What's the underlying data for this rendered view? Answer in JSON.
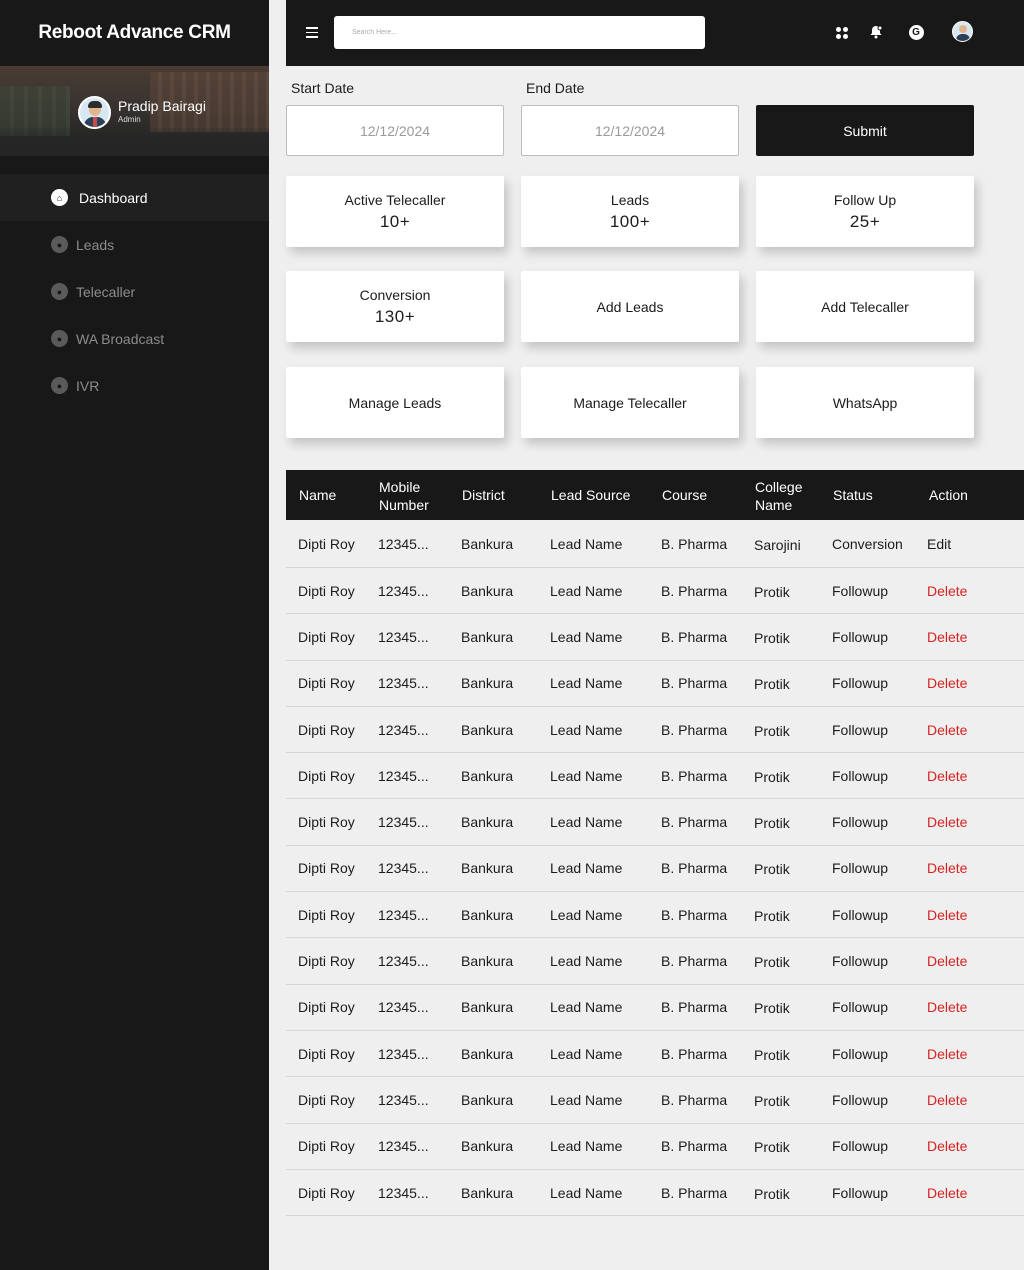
{
  "app": {
    "title": "Reboot Advance CRM"
  },
  "profile": {
    "name": "Pradip Bairagi",
    "role": "Admin"
  },
  "sidebar": {
    "items": [
      {
        "label": "Dashboard",
        "icon": "home-icon",
        "active": true
      },
      {
        "label": "Leads",
        "icon": "leads-icon",
        "active": false
      },
      {
        "label": "Telecaller",
        "icon": "telecaller-icon",
        "active": false
      },
      {
        "label": "WA Broadcast",
        "icon": "broadcast-icon",
        "active": false
      },
      {
        "label": "IVR",
        "icon": "ivr-icon",
        "active": false
      }
    ]
  },
  "header": {
    "search_placeholder": "Search Here..."
  },
  "filters": {
    "start_label": "Start Date",
    "end_label": "End Date",
    "start_value": "12/12/2024",
    "end_value": "12/12/2024",
    "submit_label": "Submit"
  },
  "cards": [
    {
      "label": "Active Telecaller",
      "value": "10+"
    },
    {
      "label": "Leads",
      "value": "100+"
    },
    {
      "label": "Follow Up",
      "value": "25+"
    },
    {
      "label": "Conversion",
      "value": "130+"
    },
    {
      "label": "Add Leads"
    },
    {
      "label": "Add Telecaller"
    },
    {
      "label": "Manage Leads"
    },
    {
      "label": "Manage Telecaller"
    },
    {
      "label": "WhatsApp"
    }
  ],
  "table": {
    "headers": [
      "Name",
      "Mobile Number",
      "District",
      "Lead Source",
      "Course",
      "College Name",
      "Status",
      "Action"
    ],
    "rows": [
      [
        "Dipti Roy",
        "12345...",
        "Bankura",
        "Lead Name",
        "B. Pharma",
        "Sarojini",
        "Conversion",
        "Edit"
      ],
      [
        "Dipti Roy",
        "12345...",
        "Bankura",
        "Lead Name",
        "B. Pharma",
        "Protik",
        "Followup",
        "Delete"
      ],
      [
        "Dipti Roy",
        "12345...",
        "Bankura",
        "Lead Name",
        "B. Pharma",
        "Protik",
        "Followup",
        "Delete"
      ],
      [
        "Dipti Roy",
        "12345...",
        "Bankura",
        "Lead Name",
        "B. Pharma",
        "Protik",
        "Followup",
        "Delete"
      ],
      [
        "Dipti Roy",
        "12345...",
        "Bankura",
        "Lead Name",
        "B. Pharma",
        "Protik",
        "Followup",
        "Delete"
      ],
      [
        "Dipti Roy",
        "12345...",
        "Bankura",
        "Lead Name",
        "B. Pharma",
        "Protik",
        "Followup",
        "Delete"
      ],
      [
        "Dipti Roy",
        "12345...",
        "Bankura",
        "Lead Name",
        "B. Pharma",
        "Protik",
        "Followup",
        "Delete"
      ],
      [
        "Dipti Roy",
        "12345...",
        "Bankura",
        "Lead Name",
        "B. Pharma",
        "Protik",
        "Followup",
        "Delete"
      ],
      [
        "Dipti Roy",
        "12345...",
        "Bankura",
        "Lead Name",
        "B. Pharma",
        "Protik",
        "Followup",
        "Delete"
      ],
      [
        "Dipti Roy",
        "12345...",
        "Bankura",
        "Lead Name",
        "B. Pharma",
        "Protik",
        "Followup",
        "Delete"
      ],
      [
        "Dipti Roy",
        "12345...",
        "Bankura",
        "Lead Name",
        "B. Pharma",
        "Protik",
        "Followup",
        "Delete"
      ],
      [
        "Dipti Roy",
        "12345...",
        "Bankura",
        "Lead Name",
        "B. Pharma",
        "Protik",
        "Followup",
        "Delete"
      ],
      [
        "Dipti Roy",
        "12345...",
        "Bankura",
        "Lead Name",
        "B. Pharma",
        "Protik",
        "Followup",
        "Delete"
      ],
      [
        "Dipti Roy",
        "12345...",
        "Bankura",
        "Lead Name",
        "B. Pharma",
        "Protik",
        "Followup",
        "Delete"
      ],
      [
        "Dipti Roy",
        "12345...",
        "Bankura",
        "Lead Name",
        "B. Pharma",
        "Protik",
        "Followup",
        "Delete"
      ]
    ]
  },
  "colors": {
    "sidebar_bg": "#181818",
    "accent_delete": "#d62222",
    "page_bg": "#efefef"
  }
}
